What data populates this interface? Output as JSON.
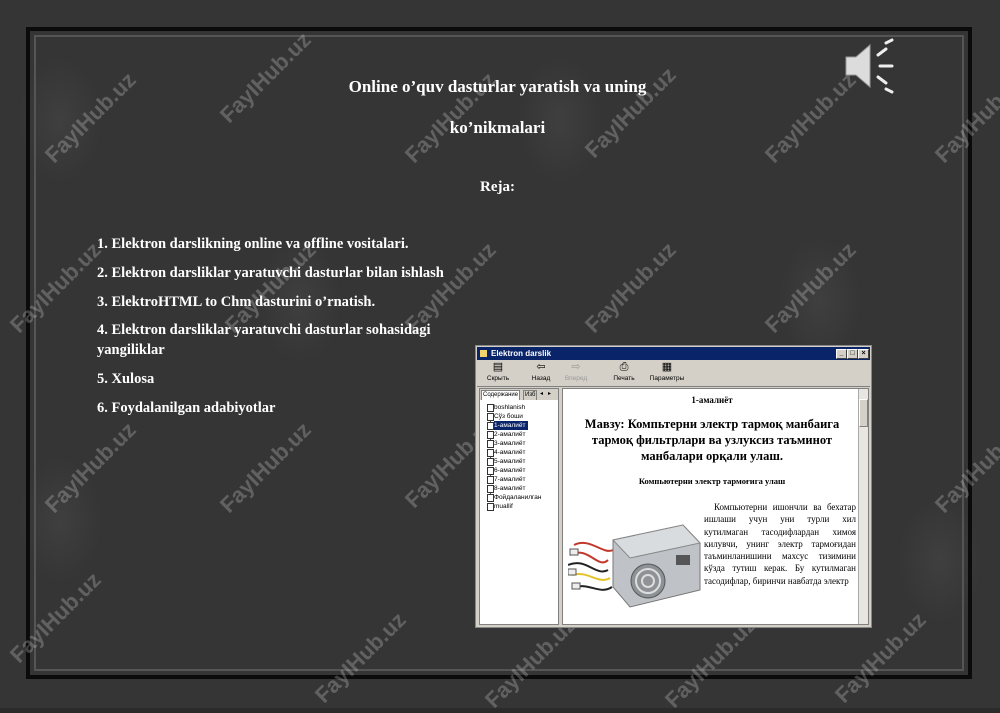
{
  "slide": {
    "title_line1": "Online o’quv dasturlar yaratish  va uning",
    "title_line2": "ko’nikmalari",
    "reja": "Reja:",
    "plan": [
      "1.  Elektron darslikning online va offline vositalari.",
      "2.  Elektron darsliklar yaratuvchi dasturlar bilan ishlash",
      "3.  ElektroHTML to Chm dasturini  o’rnatish.",
      "4.  Elektron darsliklar yaratuvchi dasturlar sohasidagi yangiliklar",
      "5.  Xulosa",
      "6.  Foydalanilgan adabiyotlar"
    ],
    "watermark": "FayIHub.uz",
    "speaker_icon": "speaker-icon"
  },
  "window": {
    "title": "Elektron darslik",
    "toolbar": [
      {
        "label": "Скрыть",
        "icon": "hide-icon",
        "enabled": true
      },
      {
        "label": "Назад",
        "icon": "back-icon",
        "enabled": true
      },
      {
        "label": "Вперед",
        "icon": "forward-icon",
        "enabled": false
      },
      {
        "label": "Печать",
        "icon": "print-icon",
        "enabled": true
      },
      {
        "label": "Параметры",
        "icon": "options-icon",
        "enabled": true
      }
    ],
    "tabs": [
      "Содержание",
      "Изб"
    ],
    "tree": [
      "boshlanish",
      "Сўз боши",
      "1-амалиёт",
      "2-амалиёт",
      "3-амалиёт",
      "4-амалиёт",
      "5-амалиёт",
      "6-амалиёт",
      "7-амалиёт",
      "8-амалиёт",
      "Фойдаланилган",
      "muallif"
    ],
    "selected_index": 2,
    "content": {
      "heading": "1-амалиёт",
      "topic": "Мавзу: Компьтерни электр тармоқ манбаига тармоқ фильтрлари ва узлуксиз таъминот манбалари орқали улаш.",
      "subheading": "Компьютерни электр тармоғига улаш",
      "paragraph": "Компьютерни ишончли ва бехатар ишлаши учун уни турли хил кутилмаган тасодифлардан химоя килувчи, унинг электр тармоғидан таъминланишини махсус тизимини кўзда тутиш керак. Бу кутилмаган тасодифлар, биринчи навбатда электр"
    }
  }
}
